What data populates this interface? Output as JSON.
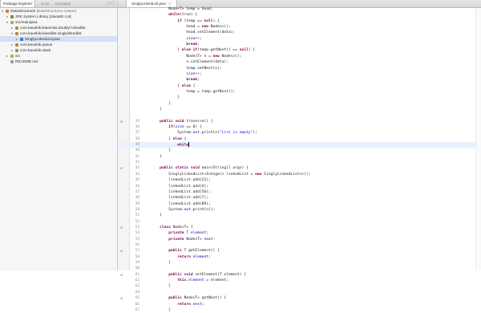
{
  "explorer": {
    "tabs": [
      {
        "label": "Package Explorer",
        "active": true
      },
      {
        "label": "JUnit",
        "active": false
      },
      {
        "label": "Navigator",
        "active": false
      }
    ],
    "tree": [
      {
        "indent": 0,
        "twisty": "▾",
        "icon_color": "#b58b2a",
        "label": "DataStructures",
        "suffix": " [DataStructures master]"
      },
      {
        "indent": 1,
        "twisty": "▸",
        "icon_color": "#8a7a5a",
        "label": "JRE System Library [JavaSE-1.6]",
        "suffix": ""
      },
      {
        "indent": 1,
        "twisty": "▾",
        "icon_color": "#c9a544",
        "label": "src/main/java",
        "suffix": ""
      },
      {
        "indent": 2,
        "twisty": "▸",
        "icon_color": "#b6854b",
        "label": "com.kaushik.linked.list.doublyl Inkedlist",
        "suffix": ""
      },
      {
        "indent": 2,
        "twisty": "▾",
        "icon_color": "#b6854b",
        "label": "com.kaushik.linkedlist.singlylinkedlist",
        "suffix": ""
      },
      {
        "indent": 3,
        "twisty": "▸",
        "icon_color": "#3a79c3",
        "label": "SinglyLinkedList.java",
        "suffix": "",
        "selected": true
      },
      {
        "indent": 2,
        "twisty": "▸",
        "icon_color": "#b6854b",
        "label": "com.kaushik.queue",
        "suffix": ""
      },
      {
        "indent": 2,
        "twisty": "▸",
        "icon_color": "#b6854b",
        "label": "com.kaushik.stack",
        "suffix": ""
      },
      {
        "indent": 1,
        "twisty": "▸",
        "icon_color": "#c9a544",
        "label": "src",
        "suffix": ""
      },
      {
        "indent": 1,
        "twisty": "",
        "icon_color": "#9a9a9a",
        "label": "README.md",
        "suffix": ""
      }
    ]
  },
  "editor": {
    "tab_label": "SinglyLinkedList.java",
    "current_line": 38,
    "lines": [
      {
        "n": "",
        "src": [
          [
            "",
            "            Node<T> temp = head;"
          ]
        ]
      },
      {
        "n": "",
        "src": [
          [
            "",
            "            "
          ],
          [
            "kw",
            "while"
          ],
          [
            "",
            ""
          ],
          [
            "",
            "(true) {"
          ]
        ]
      },
      {
        "n": "",
        "src": [
          [
            "",
            "                "
          ],
          [
            "kw",
            "if"
          ],
          [
            "",
            " (temp == "
          ],
          [
            "kw",
            "null"
          ],
          [
            "",
            ") {"
          ]
        ]
      },
      {
        "n": "",
        "src": [
          [
            "",
            "                    head = "
          ],
          [
            "kw",
            "new"
          ],
          [
            "",
            " Node<>();"
          ]
        ]
      },
      {
        "n": "",
        "src": [
          [
            "",
            "                    head.setElement(data);"
          ]
        ]
      },
      {
        "n": "",
        "src": [
          [
            "",
            "                    "
          ],
          [
            "fld",
            "size"
          ],
          [
            "",
            "++;"
          ]
        ]
      },
      {
        "n": "",
        "src": [
          [
            "",
            "                    "
          ],
          [
            "kw",
            "break"
          ],
          [
            "",
            ";"
          ]
        ]
      },
      {
        "n": "",
        "src": [
          [
            "",
            "                } "
          ],
          [
            "kw",
            "else if"
          ],
          [
            "",
            "(temp.getNext() == "
          ],
          [
            "kw",
            "null"
          ],
          [
            "",
            ") {"
          ]
        ]
      },
      {
        "n": "",
        "src": [
          [
            "",
            "                    Node<T> n = "
          ],
          [
            "kw",
            "new"
          ],
          [
            "",
            " Node<>();"
          ]
        ]
      },
      {
        "n": "",
        "src": [
          [
            "",
            "                    n.setElement(data);"
          ]
        ]
      },
      {
        "n": "",
        "src": [
          [
            "",
            "                    temp.setNext(n);"
          ]
        ]
      },
      {
        "n": "",
        "src": [
          [
            "",
            "                    "
          ],
          [
            "fld",
            "size"
          ],
          [
            "",
            "++;"
          ]
        ]
      },
      {
        "n": "",
        "src": [
          [
            "",
            "                    "
          ],
          [
            "kw",
            "break"
          ],
          [
            "",
            ";"
          ]
        ]
      },
      {
        "n": "",
        "src": [
          [
            "",
            "                } "
          ],
          [
            "kw",
            "else"
          ],
          [
            "",
            " {"
          ]
        ]
      },
      {
        "n": "",
        "src": [
          [
            "",
            "                    temp = temp.getNext();"
          ]
        ]
      },
      {
        "n": "",
        "src": [
          [
            "",
            "                }"
          ]
        ]
      },
      {
        "n": "",
        "src": [
          [
            "",
            "            }"
          ]
        ]
      },
      {
        "n": "",
        "src": [
          [
            "",
            "        }"
          ]
        ]
      },
      {
        "n": "",
        "src": [
          [
            "",
            ""
          ]
        ]
      },
      {
        "n": "35",
        "marker": "⊖",
        "src": [
          [
            "",
            "        "
          ],
          [
            "kw",
            "public void"
          ],
          [
            "",
            " traverse() {"
          ]
        ]
      },
      {
        "n": "36",
        "src": [
          [
            "",
            "            "
          ],
          [
            "kw",
            "if"
          ],
          [
            "",
            "("
          ],
          [
            "fld",
            "size"
          ],
          [
            "",
            " == 0) {"
          ]
        ]
      },
      {
        "n": "37",
        "src": [
          [
            "",
            "                System."
          ],
          [
            "fld fn",
            "out"
          ],
          [
            "",
            ".println("
          ],
          [
            "str",
            "\"List is empty\""
          ],
          [
            "",
            ");"
          ]
        ]
      },
      {
        "n": "38",
        "src": [
          [
            "",
            "            } "
          ],
          [
            "kw",
            "else"
          ],
          [
            "",
            " {"
          ]
        ]
      },
      {
        "n": "39",
        "src": [
          [
            "",
            "                "
          ],
          [
            "kw",
            "while"
          ],
          [
            "cursor",
            ""
          ]
        ]
      },
      {
        "n": "40",
        "src": [
          [
            "",
            "            }"
          ]
        ]
      },
      {
        "n": "41",
        "src": [
          [
            "",
            "        }"
          ]
        ]
      },
      {
        "n": "42",
        "src": [
          [
            "",
            ""
          ]
        ]
      },
      {
        "n": "43",
        "marker": "⊖",
        "src": [
          [
            "",
            "        "
          ],
          [
            "kw",
            "public static void"
          ],
          [
            "",
            " main(String[] args) {"
          ]
        ]
      },
      {
        "n": "44",
        "src": [
          [
            "",
            "            SinglyLinkedList<Integer> linkedList = "
          ],
          [
            "kw",
            "new"
          ],
          [
            "",
            " SinglyLinkedList<>();"
          ]
        ]
      },
      {
        "n": "45",
        "src": [
          [
            "",
            "            linkedList.add(22);"
          ]
        ]
      },
      {
        "n": "46",
        "src": [
          [
            "",
            "            linkedList.add(4);"
          ]
        ]
      },
      {
        "n": "47",
        "src": [
          [
            "",
            "            linkedList.add(56);"
          ]
        ]
      },
      {
        "n": "48",
        "src": [
          [
            "",
            "            linkedList.add(7);"
          ]
        ]
      },
      {
        "n": "49",
        "src": [
          [
            "",
            "            linkedList.add(89);"
          ]
        ]
      },
      {
        "n": "50",
        "src": [
          [
            "",
            "            System."
          ],
          [
            "fld fn",
            "out"
          ],
          [
            "",
            ".println();"
          ]
        ]
      },
      {
        "n": "51",
        "src": [
          [
            "",
            "        }"
          ]
        ]
      },
      {
        "n": "52",
        "src": [
          [
            "",
            ""
          ]
        ]
      },
      {
        "n": "53",
        "marker": "⊖",
        "src": [
          [
            "",
            "        "
          ],
          [
            "kw",
            "class"
          ],
          [
            "",
            " Node<T> {"
          ]
        ]
      },
      {
        "n": "54",
        "src": [
          [
            "",
            "            "
          ],
          [
            "kw",
            "private"
          ],
          [
            "",
            " T "
          ],
          [
            "fld",
            "element"
          ],
          [
            "",
            ";"
          ]
        ]
      },
      {
        "n": "55",
        "src": [
          [
            "",
            "            "
          ],
          [
            "kw",
            "private"
          ],
          [
            "",
            " Node<T> "
          ],
          [
            "fld",
            "next"
          ],
          [
            "",
            ";"
          ]
        ]
      },
      {
        "n": "56",
        "src": [
          [
            "",
            ""
          ]
        ]
      },
      {
        "n": "57",
        "marker": "⊖",
        "src": [
          [
            "",
            "            "
          ],
          [
            "kw",
            "public"
          ],
          [
            "",
            " T getElement() {"
          ]
        ]
      },
      {
        "n": "58",
        "src": [
          [
            "",
            "                "
          ],
          [
            "kw",
            "return"
          ],
          [
            "",
            " "
          ],
          [
            "fld",
            "element"
          ],
          [
            "",
            ";"
          ]
        ]
      },
      {
        "n": "59",
        "src": [
          [
            "",
            "            }"
          ]
        ]
      },
      {
        "n": "60",
        "src": [
          [
            "",
            ""
          ]
        ]
      },
      {
        "n": "61",
        "marker": "⊖",
        "src": [
          [
            "",
            "            "
          ],
          [
            "kw",
            "public void"
          ],
          [
            "",
            " setElement(T element) {"
          ]
        ]
      },
      {
        "n": "62",
        "src": [
          [
            "",
            "                "
          ],
          [
            "kw",
            "this"
          ],
          [
            "",
            "."
          ],
          [
            "fld",
            "element"
          ],
          [
            "",
            " = element;"
          ]
        ]
      },
      {
        "n": "63",
        "src": [
          [
            "",
            "            }"
          ]
        ]
      },
      {
        "n": "64",
        "src": [
          [
            "",
            ""
          ]
        ]
      },
      {
        "n": "65",
        "marker": "⊖",
        "src": [
          [
            "",
            "            "
          ],
          [
            "kw",
            "public"
          ],
          [
            "",
            " Node<T> getNext() {"
          ]
        ]
      },
      {
        "n": "66",
        "src": [
          [
            "",
            "                "
          ],
          [
            "kw",
            "return"
          ],
          [
            "",
            " "
          ],
          [
            "fld",
            "next"
          ],
          [
            "",
            ";"
          ]
        ]
      },
      {
        "n": "67",
        "src": [
          [
            "",
            "            }"
          ]
        ]
      }
    ]
  }
}
